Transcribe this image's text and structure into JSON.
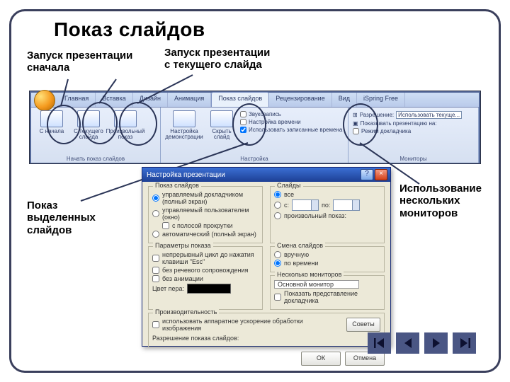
{
  "title": "Показ слайдов",
  "annotations": {
    "from_start": "Запуск презентации\nсначала",
    "from_current": "Запуск презентации\nс текущего слайда",
    "selected": "Показ\nвыделенных\nслайдов",
    "monitors": "Использование\nнескольких\nмониторов"
  },
  "ribbon": {
    "tabs": {
      "home": "Главная",
      "insert": "Вставка",
      "design": "Дизайн",
      "anim": "Анимация",
      "slideshow": "Показ слайдов",
      "review": "Рецензирование",
      "view": "Вид",
      "ispring": "iSpring Free"
    },
    "group_start": "Начать показ слайдов",
    "group_setup": "Настройка",
    "group_monitors": "Мониторы",
    "btn_from_start": "С начала",
    "btn_from_current": "С текущего слайда",
    "btn_custom": "Произвольный показ",
    "btn_setup": "Настройка демонстрации",
    "btn_hide": "Скрыть слайд",
    "chk_record": "Звукозапись",
    "chk_rehearse": "Настройка времени",
    "chk_use": "Использовать записанные времена",
    "mon_res": "Разрешение:",
    "mon_res_val": "Использовать текуще...",
    "mon_show": "Показывать презентацию на:",
    "mon_presenter": "Режим докладчика"
  },
  "dialog": {
    "title": "Настройка презентации",
    "g_show": "Показ слайдов",
    "r_full": "управляемый докладчиком (полный экран)",
    "r_window": "управляемый пользователем (окно)",
    "c_scrollbar": "с полосой прокрутки",
    "r_kiosk": "автоматический (полный экран)",
    "g_slides": "Слайды",
    "r_all": "все",
    "r_range_from": "с:",
    "r_range_to": "по:",
    "r_custom": "произвольный показ:",
    "g_options": "Параметры показа",
    "c_loop": "непрерывный цикл до нажатия клавиши \"Esc\"",
    "c_no_narr": "без речевого сопровождения",
    "c_no_anim": "без анимации",
    "pen_color": "Цвет пера:",
    "g_advance": "Смена слайдов",
    "r_manual": "вручную",
    "r_timings": "по времени",
    "g_multi": "Несколько мониторов",
    "dd_mon": "Основной монитор",
    "c_presenter": "Показать представление докладчика",
    "g_perf": "Производительность",
    "c_hw": "использовать аппаратное ускорение обработки изображения",
    "perf_tips": "Советы",
    "res_label": "Разрешение показа слайдов:",
    "ok": "ОК",
    "cancel": "Отмена"
  }
}
